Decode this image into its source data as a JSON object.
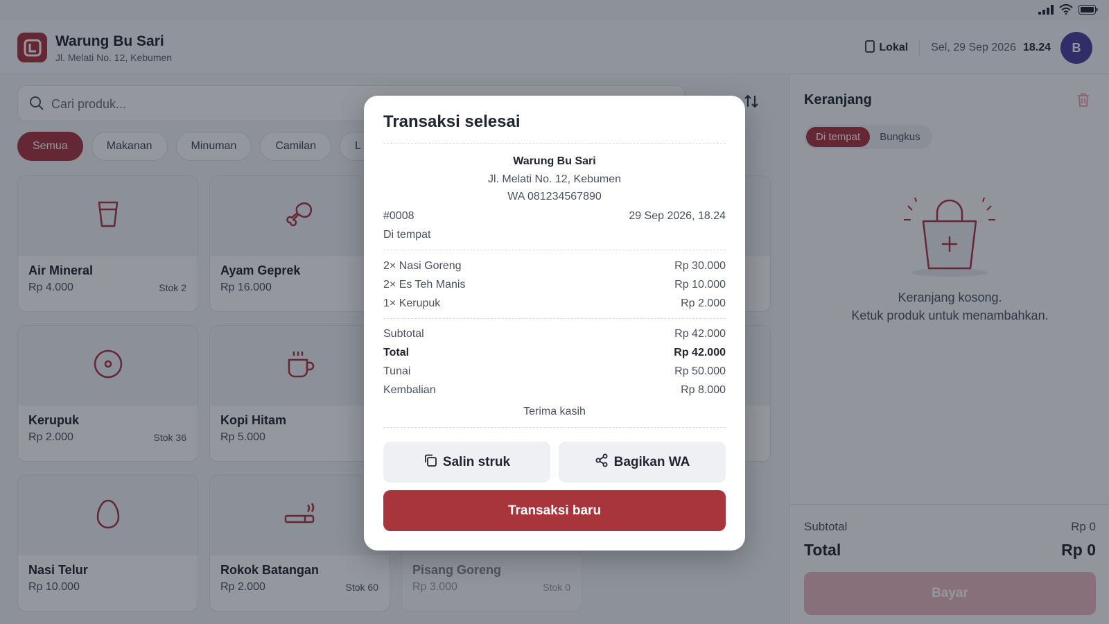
{
  "colors": {
    "accent": "#a8343c",
    "avatar": "#4b3f9e",
    "overlay": "rgba(18,24,40,0.45)"
  },
  "header": {
    "store_name": "Warung Bu Sari",
    "store_address": "Jl. Melati No. 12, Kebumen",
    "mode_label": "Lokal",
    "date": "Sel, 29 Sep 2026",
    "time": "18.24",
    "avatar_initial": "B"
  },
  "search": {
    "placeholder": "Cari produk..."
  },
  "categories": [
    "Semua",
    "Makanan",
    "Minuman",
    "Camilan",
    "L"
  ],
  "products": [
    {
      "name": "Air Mineral",
      "price": "Rp 4.000",
      "stock": "Stok 2",
      "icon": "cup-icon"
    },
    {
      "name": "Ayam Geprek",
      "price": "Rp 16.000",
      "stock": "",
      "icon": "drumstick-icon"
    },
    {
      "name": "Kerupuk",
      "price": "Rp 2.000",
      "stock": "Stok 36",
      "icon": "cracker-icon"
    },
    {
      "name": "Kopi Hitam",
      "price": "Rp 5.000",
      "stock": "",
      "icon": "coffee-icon"
    },
    {
      "name": "Nasi Telur",
      "price": "Rp 10.000",
      "stock": "",
      "icon": "egg-icon"
    },
    {
      "name": "Rokok Batangan",
      "price": "Rp 2.000",
      "stock": "Stok 60",
      "icon": "cigarette-icon"
    },
    {
      "name": "Pisang Goreng",
      "price": "Rp 3.000",
      "stock": "Stok 0",
      "icon": "banana-icon"
    }
  ],
  "cart": {
    "title": "Keranjang",
    "dine_options": [
      "Di tempat",
      "Bungkus"
    ],
    "empty_line1": "Keranjang kosong.",
    "empty_line2": "Ketuk produk untuk menambahkan.",
    "subtotal_label": "Subtotal",
    "subtotal_value": "Rp 0",
    "total_label": "Total",
    "total_value": "Rp 0",
    "pay_label": "Bayar"
  },
  "modal": {
    "title": "Transaksi selesai",
    "receipt": {
      "store_name": "Warung Bu Sari",
      "address": "Jl. Melati No. 12, Kebumen",
      "phone": "WA 081234567890",
      "number": "#0008",
      "datetime": "29 Sep 2026, 18.24",
      "order_type": "Di tempat",
      "items": [
        {
          "label": "2× Nasi Goreng",
          "amount": "Rp 30.000"
        },
        {
          "label": "2× Es Teh Manis",
          "amount": "Rp 10.000"
        },
        {
          "label": "1× Kerupuk",
          "amount": "Rp 2.000"
        }
      ],
      "subtotal_label": "Subtotal",
      "subtotal_value": "Rp 42.000",
      "total_label": "Total",
      "total_value": "Rp 42.000",
      "cash_label": "Tunai",
      "cash_value": "Rp 50.000",
      "change_label": "Kembalian",
      "change_value": "Rp 8.000",
      "thanks": "Terima kasih"
    },
    "copy_label": "Salin struk",
    "share_label": "Bagikan WA",
    "new_label": "Transaksi baru"
  }
}
